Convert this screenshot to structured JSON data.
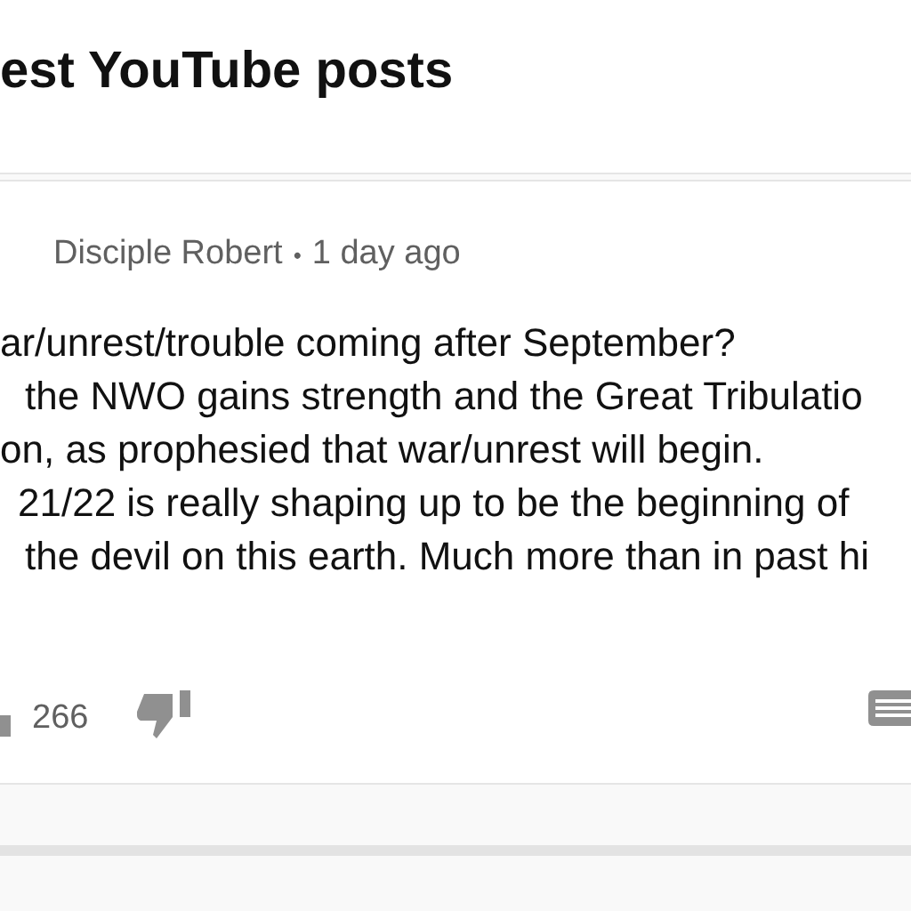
{
  "page_title": "est YouTube posts",
  "post": {
    "author": "Disciple Robert",
    "separator": "•",
    "time": "1 day ago",
    "lines": [
      "ar/unrest/trouble coming after September?",
      "the NWO gains strength and the Great Tribulatio",
      "on, as prophesied that war/unrest will begin.",
      "21/22 is really shaping up to be the beginning of",
      "the devil on this earth. Much more than in past hi"
    ],
    "likes": "266"
  }
}
